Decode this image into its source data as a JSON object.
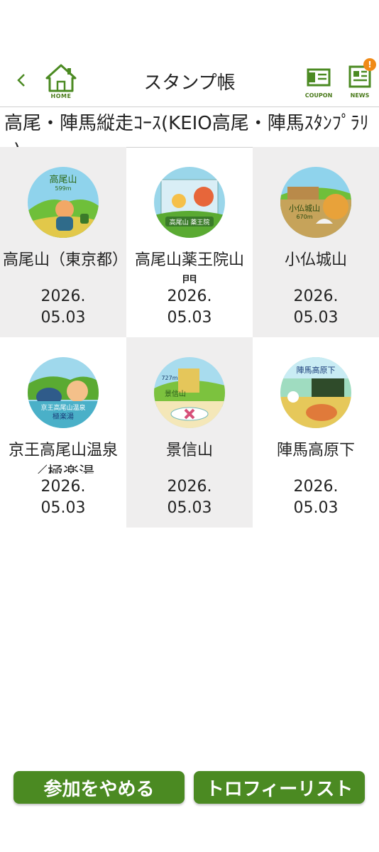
{
  "header": {
    "title": "スタンプ帳",
    "home_label": "HOME",
    "coupon_label": "COUPON",
    "news_label": "NEWS",
    "news_badge": "!"
  },
  "course": {
    "title": "高尾・陣馬縦走ｺｰｽ(KEIO高尾・陣馬ｽﾀﾝﾌﾟﾗﾘｰ)"
  },
  "stamps": [
    {
      "name": "高尾山（東京都）",
      "date": "2026.\n05.03",
      "art_text": "高尾山",
      "art_sub": "599m"
    },
    {
      "name": "高尾山薬王院山門",
      "date": "2026.\n05.03",
      "art_text": "高尾山 薬王院",
      "art_sub": ""
    },
    {
      "name": "小仏城山",
      "date": "2026.\n05.03",
      "art_text": "小仏城山",
      "art_sub": "670m"
    },
    {
      "name": "京王高尾山温泉／極楽湯",
      "date": "2026.\n05.03",
      "art_text": "京王高尾山温泉",
      "art_sub": "極楽湯"
    },
    {
      "name": "景信山",
      "date": "2026.\n05.03",
      "art_text": "景信山",
      "art_sub": "727m"
    },
    {
      "name": "陣馬高原下",
      "date": "2026.\n05.03",
      "art_text": "陣馬高原下",
      "art_sub": ""
    }
  ],
  "buttons": {
    "quit": "参加をやめる",
    "trophy": "トロフィーリスト"
  },
  "colors": {
    "accent": "#4b8a22",
    "badge": "#f08a16",
    "cell_grey": "#efeeee"
  }
}
